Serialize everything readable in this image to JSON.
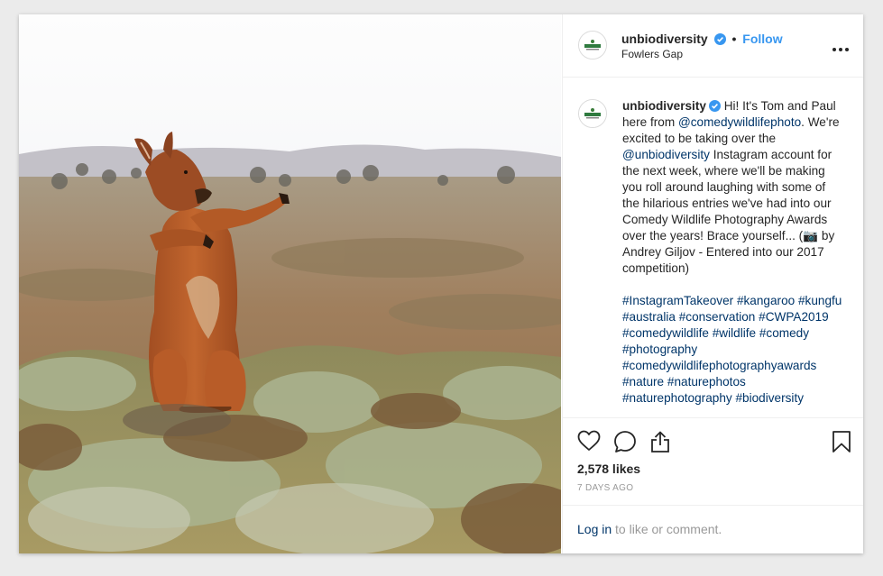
{
  "post": {
    "username": "unbiodiversity",
    "follow_label": "Follow",
    "dot": "•",
    "location": "Fowlers Gap",
    "caption_intro": "Hi! It's Tom and Paul here from ",
    "mention_1": "@comedywildlifephoto",
    "caption_mid_1": ". We're excited to be taking over the ",
    "mention_2": "@unbiodiversity",
    "caption_mid_2": " Instagram account for the next week, where we'll be making you roll around laughing with some of the hilarious entries we've had into our Comedy Wildlife Photography Awards over the years! Brace yourself... (",
    "camera_emoji": "📷",
    "caption_end": " by Andrey Giljov - Entered into our 2017 competition)",
    "hashtags": [
      "#InstagramTakeover",
      "#kangaroo",
      "#kungfu",
      "#australia",
      "#conservation",
      "#CWPA2019",
      "#comedywildlife",
      "#wildlife",
      "#comedy",
      "#photography",
      "#comedywildlifephotographyawards",
      "#nature",
      "#naturephotos",
      "#naturephotography",
      "#biodiversity"
    ],
    "likes": "2,578 likes",
    "time": "7 DAYS AGO",
    "login_link": "Log in",
    "login_suffix": " to like or comment."
  },
  "icons": {
    "verified": "verified-badge-icon",
    "more": "more-options-icon",
    "like": "heart-icon",
    "comment": "comment-bubble-icon",
    "share": "share-icon",
    "save": "bookmark-icon"
  },
  "colors": {
    "accent": "#3897f0",
    "link": "#003569",
    "muted": "#999999",
    "text": "#262626"
  }
}
